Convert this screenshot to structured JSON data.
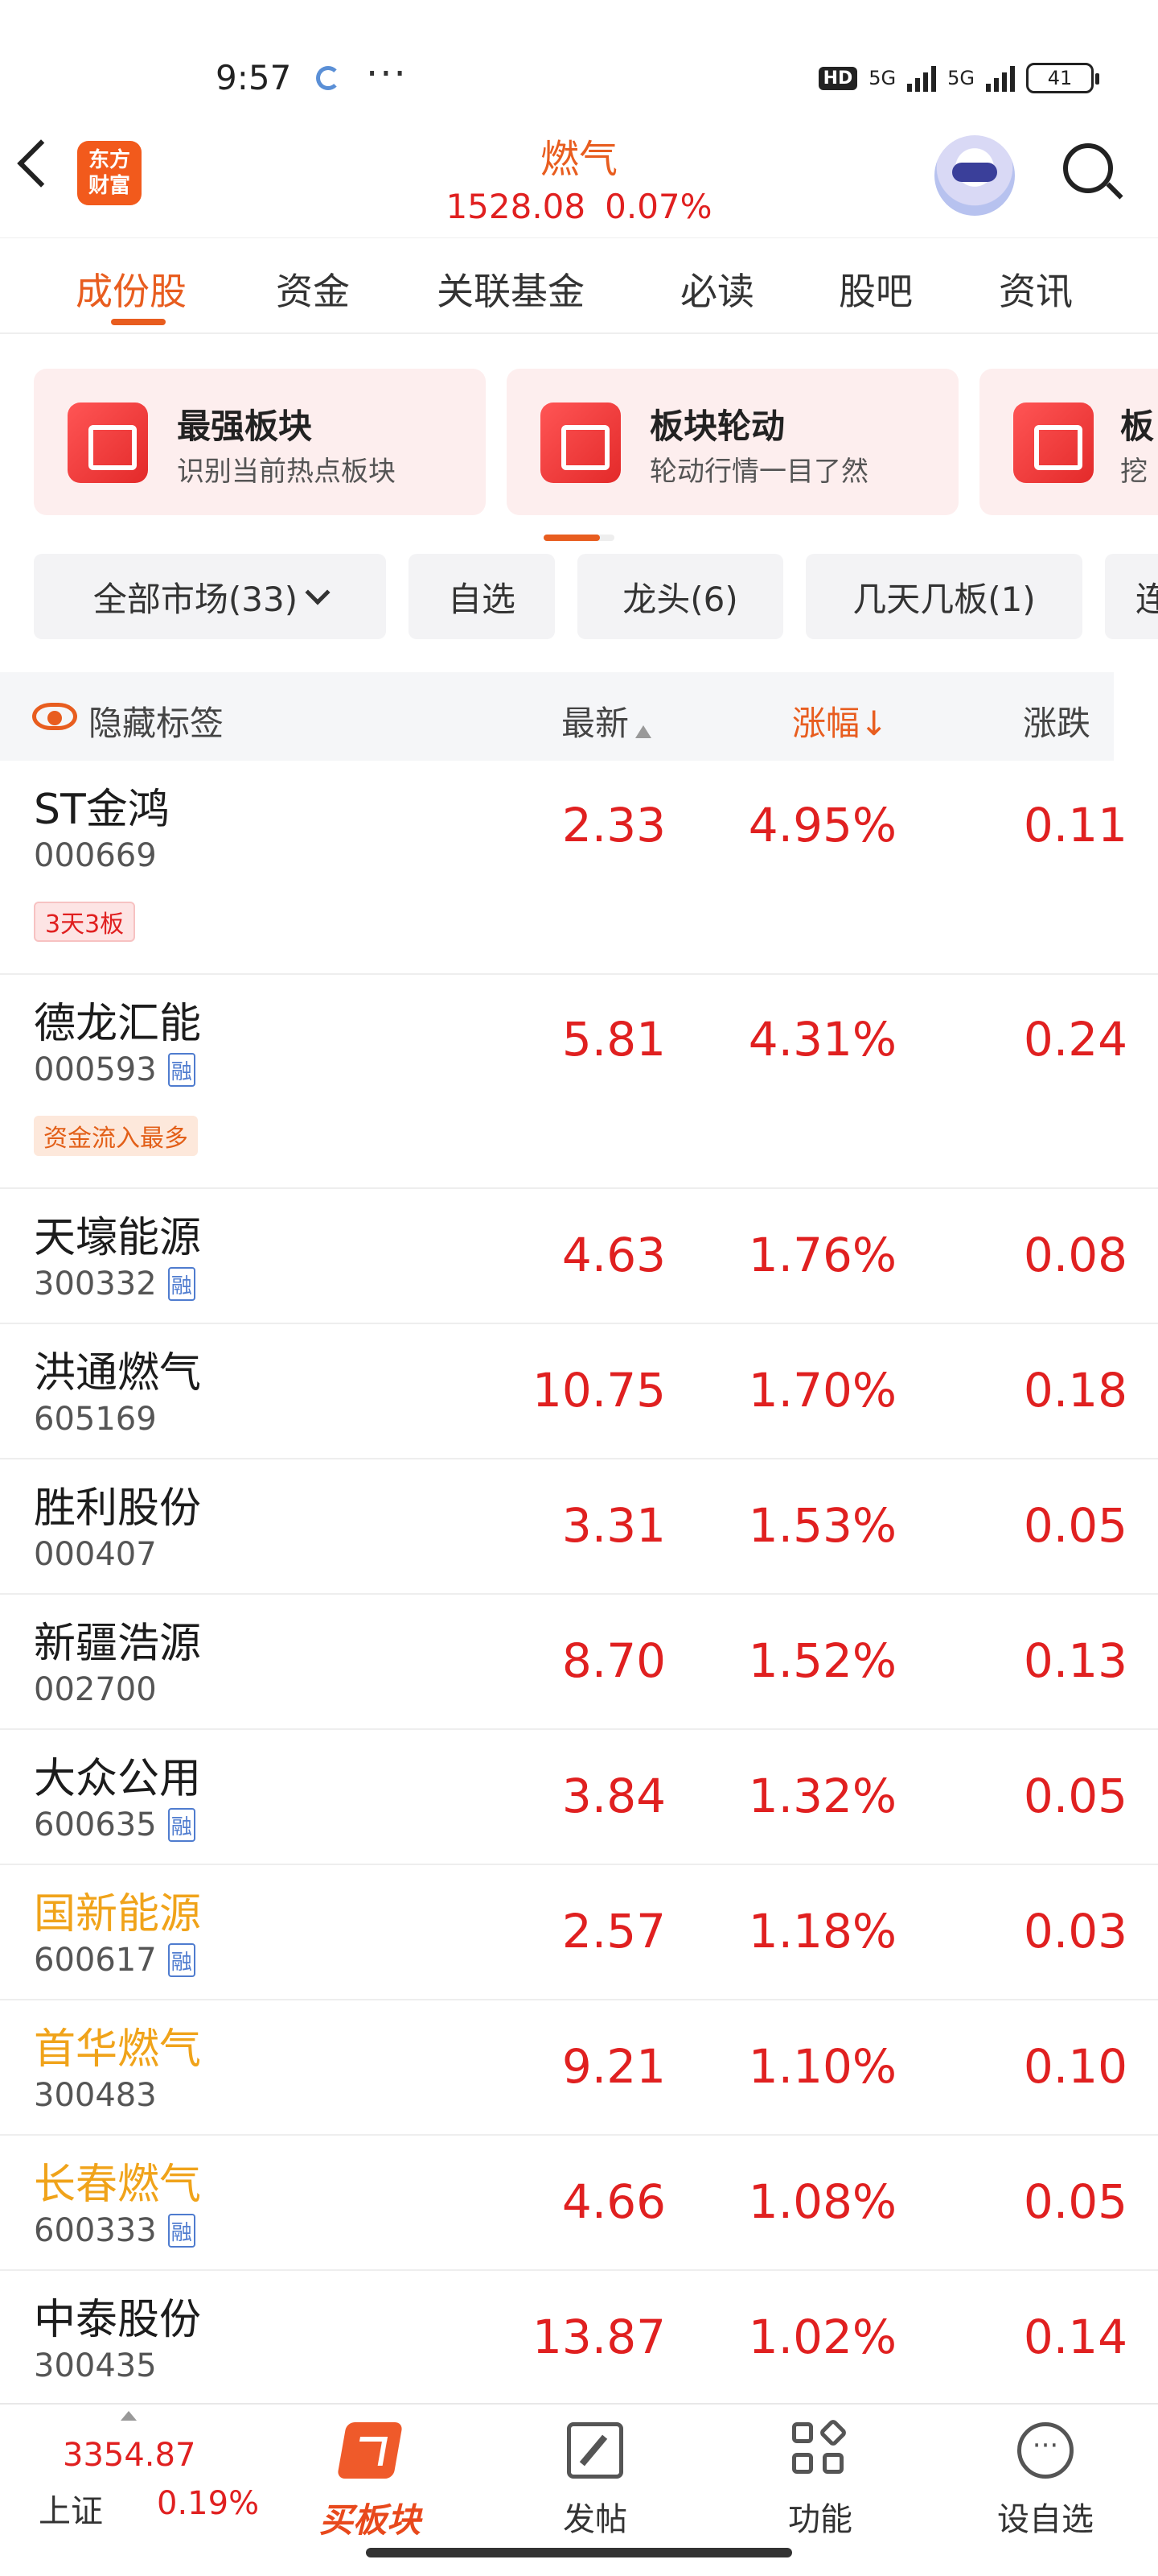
{
  "status_bar": {
    "time": "9:57",
    "dots": "···",
    "hd": "HD",
    "net1": "5G",
    "net2": "5G",
    "battery": "41"
  },
  "header": {
    "logo_text": "东方\n财富",
    "title": "燃气",
    "index_value": "1528.08",
    "index_change": "0.07%"
  },
  "tabs": [
    "成份股",
    "资金",
    "关联基金",
    "必读",
    "股吧",
    "资讯"
  ],
  "active_tab": "成份股",
  "feature_cards": [
    {
      "title": "最强板块",
      "desc": "识别当前热点板块"
    },
    {
      "title": "板块轮动",
      "desc": "轮动行情一目了然"
    },
    {
      "title": "板",
      "desc": "挖"
    }
  ],
  "filters": [
    {
      "label": "全部市场(33)"
    },
    {
      "label": "自选"
    },
    {
      "label": "龙头(6)"
    },
    {
      "label": "几天几板(1)"
    },
    {
      "label": "连"
    }
  ],
  "table_header": {
    "hide_tags": "隐藏标签",
    "col_latest": "最新",
    "col_change_pct": "涨幅",
    "col_change": "涨跌",
    "sort_arrow": "↓"
  },
  "stocks": [
    {
      "name": "ST金鸿",
      "code": "000669",
      "rong": false,
      "tag": "3天3板",
      "tag_style": "red",
      "price": "2.33",
      "pct": "4.95%",
      "change": "0.11",
      "highlight": false
    },
    {
      "name": "德龙汇能",
      "code": "000593",
      "rong": true,
      "tag": "资金流入最多",
      "tag_style": "orange",
      "price": "5.81",
      "pct": "4.31%",
      "change": "0.24",
      "highlight": false
    },
    {
      "name": "天壕能源",
      "code": "300332",
      "rong": true,
      "tag": "",
      "price": "4.63",
      "pct": "1.76%",
      "change": "0.08",
      "highlight": false
    },
    {
      "name": "洪通燃气",
      "code": "605169",
      "rong": false,
      "tag": "",
      "price": "10.75",
      "pct": "1.70%",
      "change": "0.18",
      "highlight": false
    },
    {
      "name": "胜利股份",
      "code": "000407",
      "rong": false,
      "tag": "",
      "price": "3.31",
      "pct": "1.53%",
      "change": "0.05",
      "highlight": false
    },
    {
      "name": "新疆浩源",
      "code": "002700",
      "rong": false,
      "tag": "",
      "price": "8.70",
      "pct": "1.52%",
      "change": "0.13",
      "highlight": false
    },
    {
      "name": "大众公用",
      "code": "600635",
      "rong": true,
      "tag": "",
      "price": "3.84",
      "pct": "1.32%",
      "change": "0.05",
      "highlight": false
    },
    {
      "name": "国新能源",
      "code": "600617",
      "rong": true,
      "tag": "",
      "price": "2.57",
      "pct": "1.18%",
      "change": "0.03",
      "highlight": true
    },
    {
      "name": "首华燃气",
      "code": "300483",
      "rong": false,
      "tag": "",
      "price": "9.21",
      "pct": "1.10%",
      "change": "0.10",
      "highlight": true
    },
    {
      "name": "长春燃气",
      "code": "600333",
      "rong": true,
      "tag": "",
      "price": "4.66",
      "pct": "1.08%",
      "change": "0.05",
      "highlight": true
    },
    {
      "name": "中泰股份",
      "code": "300435",
      "rong": false,
      "tag": "",
      "price": "13.87",
      "pct": "1.02%",
      "change": "0.14",
      "highlight": false
    }
  ],
  "rong_label": "融",
  "bottom_nav": {
    "index_value": "3354.87",
    "index_name": "上证",
    "index_pct": "0.19%",
    "items": [
      "买板块",
      "发帖",
      "功能",
      "设自选"
    ]
  },
  "colors": {
    "accent": "#e85d1f",
    "up": "#e02020",
    "highlight_name": "#f0a31a"
  }
}
